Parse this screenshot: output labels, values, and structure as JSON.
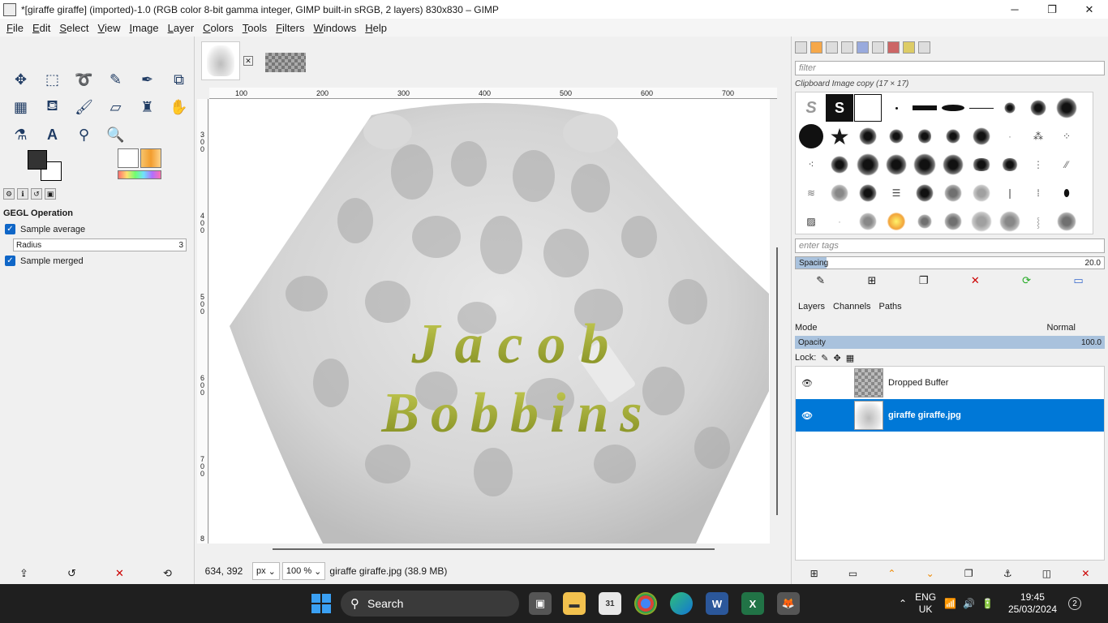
{
  "window": {
    "title": "*[giraffe giraffe] (imported)-1.0 (RGB color 8-bit gamma integer, GIMP built-in sRGB, 2 layers) 830x830 – GIMP",
    "minimize": "─",
    "maximize": "❐",
    "close": "✕"
  },
  "menubar": [
    "File",
    "Edit",
    "Select",
    "View",
    "Image",
    "Layer",
    "Colors",
    "Tools",
    "Filters",
    "Windows",
    "Help"
  ],
  "tool_options": {
    "title": "GEGL Operation",
    "sample_average": "Sample average",
    "radius_label": "Radius",
    "radius_value": "3",
    "sample_merged": "Sample merged"
  },
  "canvas": {
    "ruler_ticks": [
      "100",
      "200",
      "300",
      "400",
      "500",
      "600",
      "700"
    ],
    "ruler_left": [
      "300",
      "400",
      "500",
      "600",
      "700",
      "8"
    ],
    "text_line1": "Jacob",
    "text_line2": "Bobbins"
  },
  "statusbar": {
    "coords": "634, 392",
    "unit": "px",
    "zoom": "100 %",
    "file_info": "giraffe giraffe.jpg (38.9 MB)"
  },
  "brushes": {
    "filter_placeholder": "filter",
    "current_brush": "Clipboard Image copy (17 × 17)",
    "tags_placeholder": "enter tags",
    "spacing_label": "Spacing",
    "spacing_value": "20.0",
    "spacing_fraction": 0.1
  },
  "layers": {
    "tabs": [
      "Layers",
      "Channels",
      "Paths"
    ],
    "mode_label": "Mode",
    "mode_value": "Normal",
    "opacity_label": "Opacity",
    "opacity_value": "100.0",
    "lock_label": "Lock:",
    "items": [
      {
        "name": "Dropped Buffer",
        "active": false
      },
      {
        "name": "giraffe giraffe.jpg",
        "active": true
      }
    ]
  },
  "taskbar": {
    "search": "Search",
    "lang_line1": "ENG",
    "lang_line2": "UK",
    "time": "19:45",
    "date": "25/03/2024",
    "notifications": "2"
  },
  "colors": {
    "accent": "#0078d7",
    "text_gold": "#9aa62a"
  }
}
